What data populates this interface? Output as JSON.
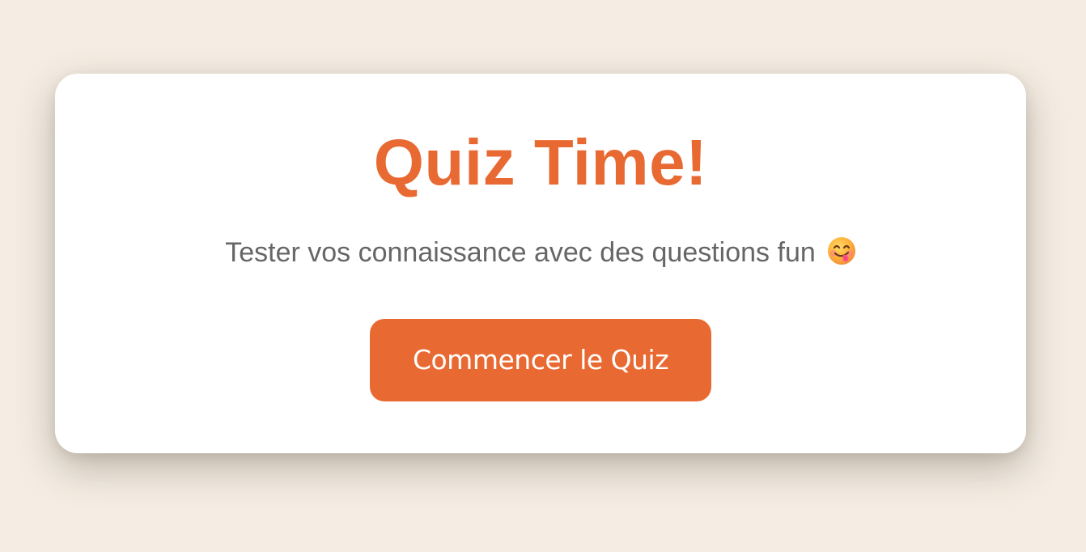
{
  "card": {
    "title": "Quiz Time!",
    "subtitle": "Tester vos connaissance avec des questions fun",
    "subtitle_emoji": "face-savoring-food-icon",
    "start_button_label": "Commencer le Quiz"
  },
  "colors": {
    "page_background": "#f5ede3",
    "card_background": "#ffffff",
    "accent": "#e86a32",
    "subtitle_text": "#666666",
    "button_text": "#ffffff"
  }
}
